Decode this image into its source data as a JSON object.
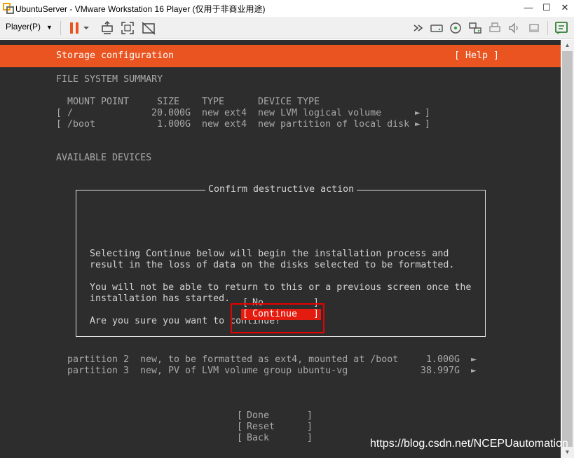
{
  "window": {
    "title": "UbuntuServer - VMware Workstation 16 Player (仅用于非商业用途)",
    "minimize": "—",
    "maximize": "☐",
    "close": "✕"
  },
  "toolbar": {
    "player_label": "Player(P)",
    "player_caret": "▼"
  },
  "installer": {
    "header_title": "Storage configuration",
    "help_label": "[ Help ]",
    "fs_summary_heading": "FILE SYSTEM SUMMARY",
    "columns": {
      "mount_point": "MOUNT POINT",
      "size": "SIZE",
      "type": "TYPE",
      "device_type": "DEVICE TYPE"
    },
    "mounts": [
      {
        "open": "[",
        "mount": "/",
        "size": "20.000G",
        "type": "new ext4",
        "device_type": "new LVM logical volume",
        "arrow": "►",
        "close": "]"
      },
      {
        "open": "[",
        "mount": "/boot",
        "size": "1.000G",
        "type": "new ext4",
        "device_type": "new partition of local disk",
        "arrow": "►",
        "close": "]"
      }
    ],
    "available_heading": "AVAILABLE DEVICES",
    "partitions": [
      {
        "name": "partition 2",
        "desc": "new, to be formatted as ext4, mounted at /boot",
        "size": "1.000G",
        "arrow": "►"
      },
      {
        "name": "partition 3",
        "desc": "new, PV of LVM volume group ubuntu-vg",
        "size": "38.997G",
        "arrow": "►"
      }
    ],
    "bottom_buttons": [
      {
        "open": "[",
        "label": "Done",
        "close": "]"
      },
      {
        "open": "[",
        "label": "Reset",
        "close": "]"
      },
      {
        "open": "[",
        "label": "Back",
        "close": "]"
      }
    ]
  },
  "dialog": {
    "title": "Confirm destructive action",
    "paragraph1": [
      "Selecting Continue below will begin the installation process and",
      "result in the loss of data on the disks selected to be formatted."
    ],
    "paragraph2": [
      "You will not be able to return to this or a previous screen once the",
      "installation has started."
    ],
    "question": "Are you sure you want to continue?",
    "no_button": {
      "open": "[",
      "label": "No",
      "close": "]"
    },
    "continue_button": {
      "open": "[",
      "label": "Continue",
      "close": "]"
    }
  },
  "watermark": "https://blog.csdn.net/NCEPUautomation",
  "colors": {
    "ubuntu_orange": "#e95420",
    "terminal_bg": "#2d2d2d",
    "selected_red": "#e41b0f",
    "annotation_red": "#e60000"
  },
  "icons": [
    "vmware-icon",
    "pause-icon",
    "send-keys-icon",
    "fullscreen-icon",
    "unity-icon",
    "forward-icon",
    "hdd-icon",
    "cdrom-icon",
    "network-icon",
    "printer-icon",
    "sound-icon",
    "usb-icon",
    "message-icon"
  ]
}
